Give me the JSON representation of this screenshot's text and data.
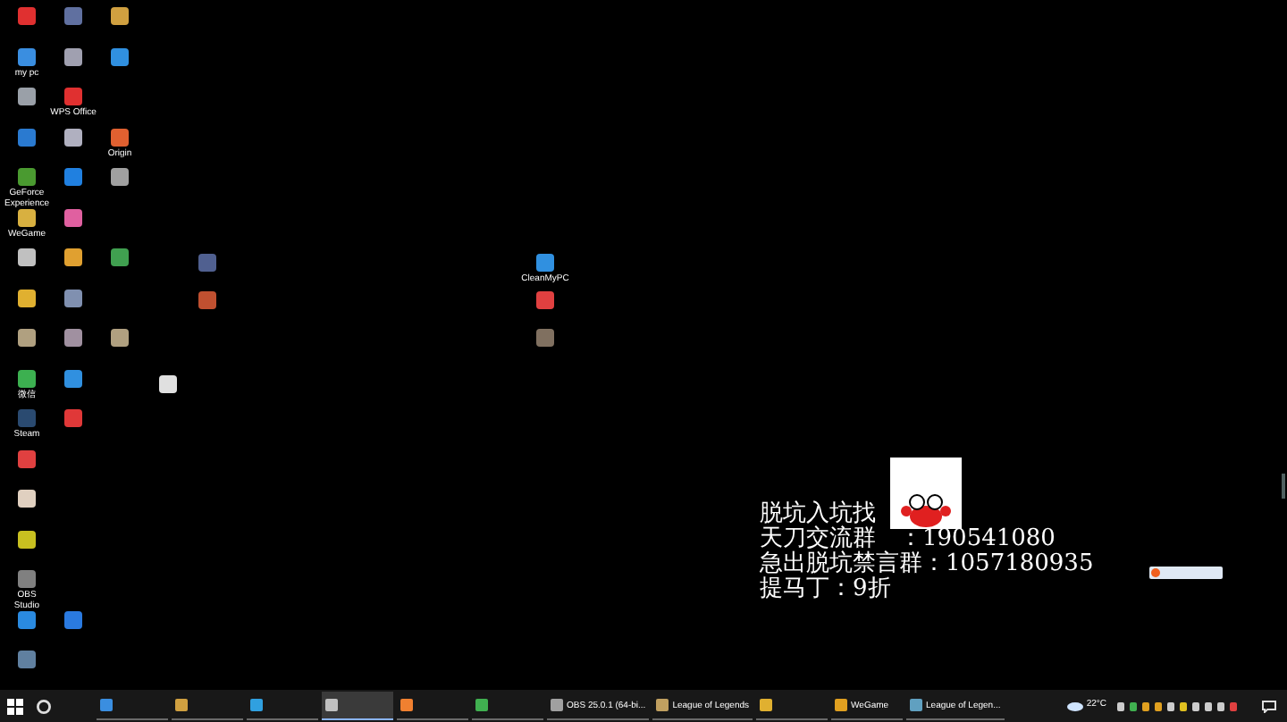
{
  "desktop": {
    "left_columns": [
      {
        "icons": [
          {
            "color": "#e03030"
          },
          {
            "label": "my pc",
            "color": "#3a8ee0"
          },
          {
            "color": "#9aa0a8"
          },
          {
            "color": "#2a7ad0"
          },
          {
            "label": "GeForce Experience",
            "color": "#4a9a30"
          },
          {
            "label": "WeGame",
            "color": "#d8b040"
          },
          {
            "color": "#c0c0c0"
          },
          {
            "color": "#e0b030"
          },
          {
            "color": "#b0a080"
          },
          {
            "label": "微信",
            "color": "#3cb050"
          },
          {
            "label": "Steam",
            "color": "#2a4a70"
          },
          {
            "color": "#e04040"
          },
          {
            "color": "#e0d0c0"
          },
          {
            "color": "#c8c020"
          },
          {
            "label": "OBS Studio",
            "color": "#808080"
          },
          {
            "color": "#2a8ae0"
          },
          {
            "color": "#6080a0"
          }
        ]
      },
      {
        "icons": [
          {
            "color": "#6070a0"
          },
          {
            "color": "#a0a0b0"
          },
          {
            "label": "WPS Office",
            "color": "#e03030"
          },
          {
            "color": "#b0b0c0"
          },
          {
            "color": "#2080e0"
          },
          {
            "color": "#e060a0"
          },
          {
            "color": "#e0a030"
          },
          {
            "color": "#8090b0"
          },
          {
            "color": "#a090a0"
          },
          {
            "color": "#3090e0"
          },
          {
            "color": "#e03838"
          },
          {
            "color": "#2a7ae0"
          }
        ]
      },
      {
        "icons": [
          {
            "color": "#d0a040"
          },
          {
            "color": "#3090e0"
          },
          {
            "label": "Origin",
            "color": "#e06030"
          },
          {
            "color": "#a0a0a0"
          },
          {
            "color": "#40a050"
          },
          {
            "color": "#b0a080"
          }
        ]
      }
    ],
    "middle_icons": [
      {
        "color": "#506090"
      },
      {
        "color": "#c05030"
      },
      {
        "color": "#e0e0e0"
      }
    ],
    "right_icons": [
      {
        "label": "CleanMyPC",
        "color": "#3090e0"
      },
      {
        "color": "#e04040"
      },
      {
        "color": "#807060"
      }
    ]
  },
  "overlay_text": [
    "脱坑入坑找",
    "天刀交流群　：190541080",
    "急出脱坑禁言群：1057180935",
    "提马丁：9折"
  ],
  "taskbar": {
    "windows": [
      {
        "selected": false,
        "color": "#3a8ee0"
      },
      {
        "selected": false,
        "color": "#d0a040"
      },
      {
        "selected": false,
        "color": "#30a0e0"
      },
      {
        "selected": true,
        "color": "#c0c0c0"
      },
      {
        "selected": false,
        "color": "#f08030"
      },
      {
        "selected": false,
        "color": "#40b050"
      },
      {
        "label": "OBS 25.0.1 (64-bi...",
        "selected": false,
        "color": "#a0a0a0"
      },
      {
        "label": "League of Legends",
        "selected": false,
        "color": "#c0a060"
      },
      {
        "selected": false,
        "color": "#e0b030"
      },
      {
        "label": "WeGame",
        "selected": false,
        "color": "#e0a020"
      },
      {
        "label": "League of Legen...",
        "selected": false,
        "color": "#60a0c0"
      }
    ],
    "weather": "22°C"
  }
}
